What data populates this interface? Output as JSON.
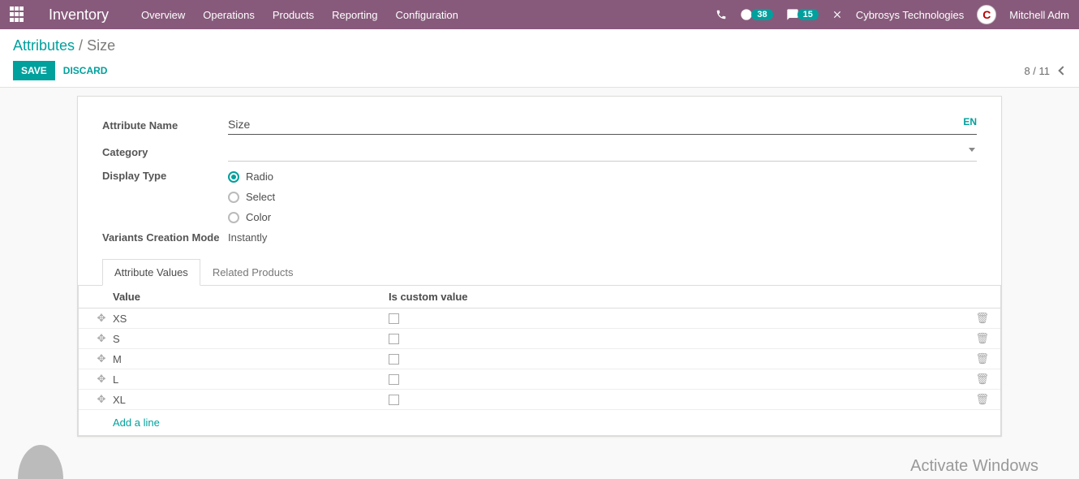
{
  "nav": {
    "app_title": "Inventory",
    "menu": [
      "Overview",
      "Operations",
      "Products",
      "Reporting",
      "Configuration"
    ],
    "badge_clock": "38",
    "badge_chat": "15",
    "company": "Cybrosys Technologies",
    "avatar_letter": "C",
    "user": "Mitchell Adm"
  },
  "breadcrumb": {
    "root": "Attributes",
    "sep": " / ",
    "current": "Size"
  },
  "buttons": {
    "save": "Save",
    "discard": "Discard"
  },
  "pager": "8 / 11",
  "form": {
    "attr_name_label": "Attribute Name",
    "attr_name_value": "Size",
    "lang": "EN",
    "category_label": "Category",
    "category_value": "",
    "display_type_label": "Display Type",
    "display_options": {
      "radio": "Radio",
      "select": "Select",
      "color": "Color"
    },
    "variants_label": "Variants Creation Mode",
    "variants_value": "Instantly"
  },
  "tabs": {
    "values": "Attribute Values",
    "related": "Related Products"
  },
  "table": {
    "head_value": "Value",
    "head_custom": "Is custom value",
    "rows": [
      {
        "value": "XS"
      },
      {
        "value": "S"
      },
      {
        "value": "M"
      },
      {
        "value": "L"
      },
      {
        "value": "XL"
      }
    ],
    "add_line": "Add a line"
  },
  "watermark": "Activate Windows"
}
